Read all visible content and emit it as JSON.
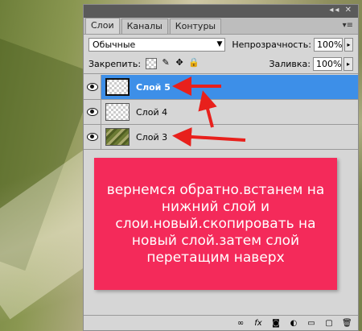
{
  "tabs": [
    "Слои",
    "Каналы",
    "Контуры"
  ],
  "blend_mode": "Обычные",
  "opacity_label": "Непрозрачность:",
  "opacity_value": "100%",
  "lock_label": "Закрепить:",
  "fill_label": "Заливка:",
  "fill_value": "100%",
  "layers": [
    {
      "name": "Слой 5",
      "active": true
    },
    {
      "name": "Слой 4",
      "active": false
    },
    {
      "name": "Слой 3",
      "active": false
    }
  ],
  "annotation": "вернемся обратно.встанем на нижний слой и слои.новый.скопировать на новый слой.затем слой перетащим наверх",
  "colors": {
    "selection": "#3d8fe8",
    "note_bg": "#f42a5a",
    "arrow": "#e8201c"
  }
}
